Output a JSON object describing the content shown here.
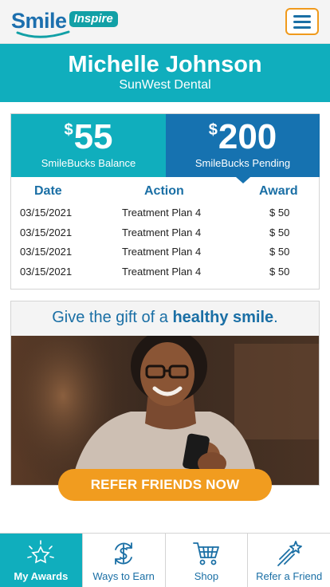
{
  "header": {
    "logo_word": "Smile",
    "logo_badge": "Inspire",
    "menu_icon": "hamburger-icon"
  },
  "profile": {
    "name": "Michelle Johnson",
    "practice": "SunWest Dental"
  },
  "balance": {
    "currency": "$",
    "balance_amount": "55",
    "balance_label": "SmileBucks Balance",
    "pending_amount": "200",
    "pending_label": "SmileBucks Pending"
  },
  "history": {
    "columns": [
      "Date",
      "Action",
      "Award"
    ],
    "rows": [
      {
        "date": "03/15/2021",
        "action": "Treatment Plan 4",
        "award": "$ 50"
      },
      {
        "date": "03/15/2021",
        "action": "Treatment Plan 4",
        "award": "$ 50"
      },
      {
        "date": "03/15/2021",
        "action": "Treatment Plan 4",
        "award": "$ 50"
      },
      {
        "date": "03/15/2021",
        "action": "Treatment Plan 4",
        "award": "$ 50"
      }
    ]
  },
  "promo": {
    "text_before": "Give the gift of a ",
    "text_bold": "healthy smile",
    "text_after": ".",
    "cta_label": "REFER FRIENDS NOW"
  },
  "nav": {
    "items": [
      {
        "label": "My Awards",
        "icon": "sparkle-icon",
        "active": true
      },
      {
        "label": "Ways to Earn",
        "icon": "dollar-cycle-icon",
        "active": false
      },
      {
        "label": "Shop",
        "icon": "cart-icon",
        "active": false
      },
      {
        "label": "Refer a Friend",
        "icon": "shooting-star-icon",
        "active": false
      }
    ]
  },
  "colors": {
    "teal": "#10aebd",
    "blue": "#1672b0",
    "orange": "#f19c1f",
    "text_blue": "#1a6fa5"
  }
}
